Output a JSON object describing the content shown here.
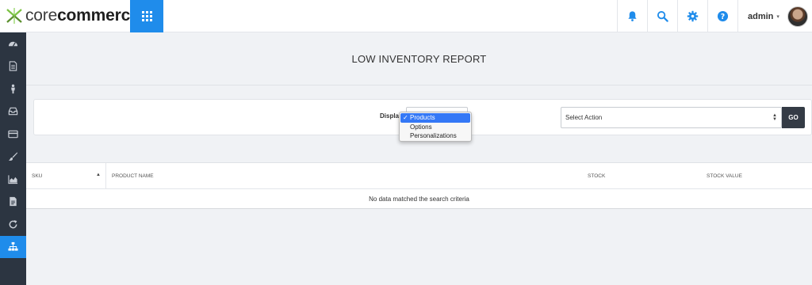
{
  "header": {
    "logo": {
      "part1": "core",
      "part2": "commerce"
    },
    "apps_icon": "grid-icon",
    "icons": [
      "bell-icon",
      "search-icon",
      "gear-icon",
      "help-icon"
    ],
    "user": {
      "name": "admin",
      "caret": "▾"
    },
    "accent_color": "#1f8ceb"
  },
  "sidebar": {
    "items": [
      {
        "icon": "dashboard-icon",
        "active": false
      },
      {
        "icon": "document-icon",
        "active": false
      },
      {
        "icon": "customer-icon",
        "active": false
      },
      {
        "icon": "inbox-icon",
        "active": false
      },
      {
        "icon": "card-icon",
        "active": false
      },
      {
        "icon": "brush-icon",
        "active": false
      },
      {
        "icon": "area-chart-icon",
        "active": false
      },
      {
        "icon": "report-file-icon",
        "active": false
      },
      {
        "icon": "refresh-icon",
        "active": false
      },
      {
        "icon": "sitemap-icon",
        "active": true
      }
    ],
    "background": "#2c3541"
  },
  "page": {
    "title": "LOW INVENTORY REPORT"
  },
  "filters": {
    "display_label": "Display",
    "display_options": [
      "Products",
      "Options",
      "Personalizations"
    ],
    "display_selected": "Products",
    "checkmark": "✓",
    "action_select": "Select Action",
    "go_label": "GO"
  },
  "table": {
    "columns": [
      "SKU",
      "PRODUCT NAME",
      "STOCK",
      "STOCK VALUE"
    ],
    "sort_indicator": "▲",
    "empty_message": "No data matched the search criteria"
  }
}
